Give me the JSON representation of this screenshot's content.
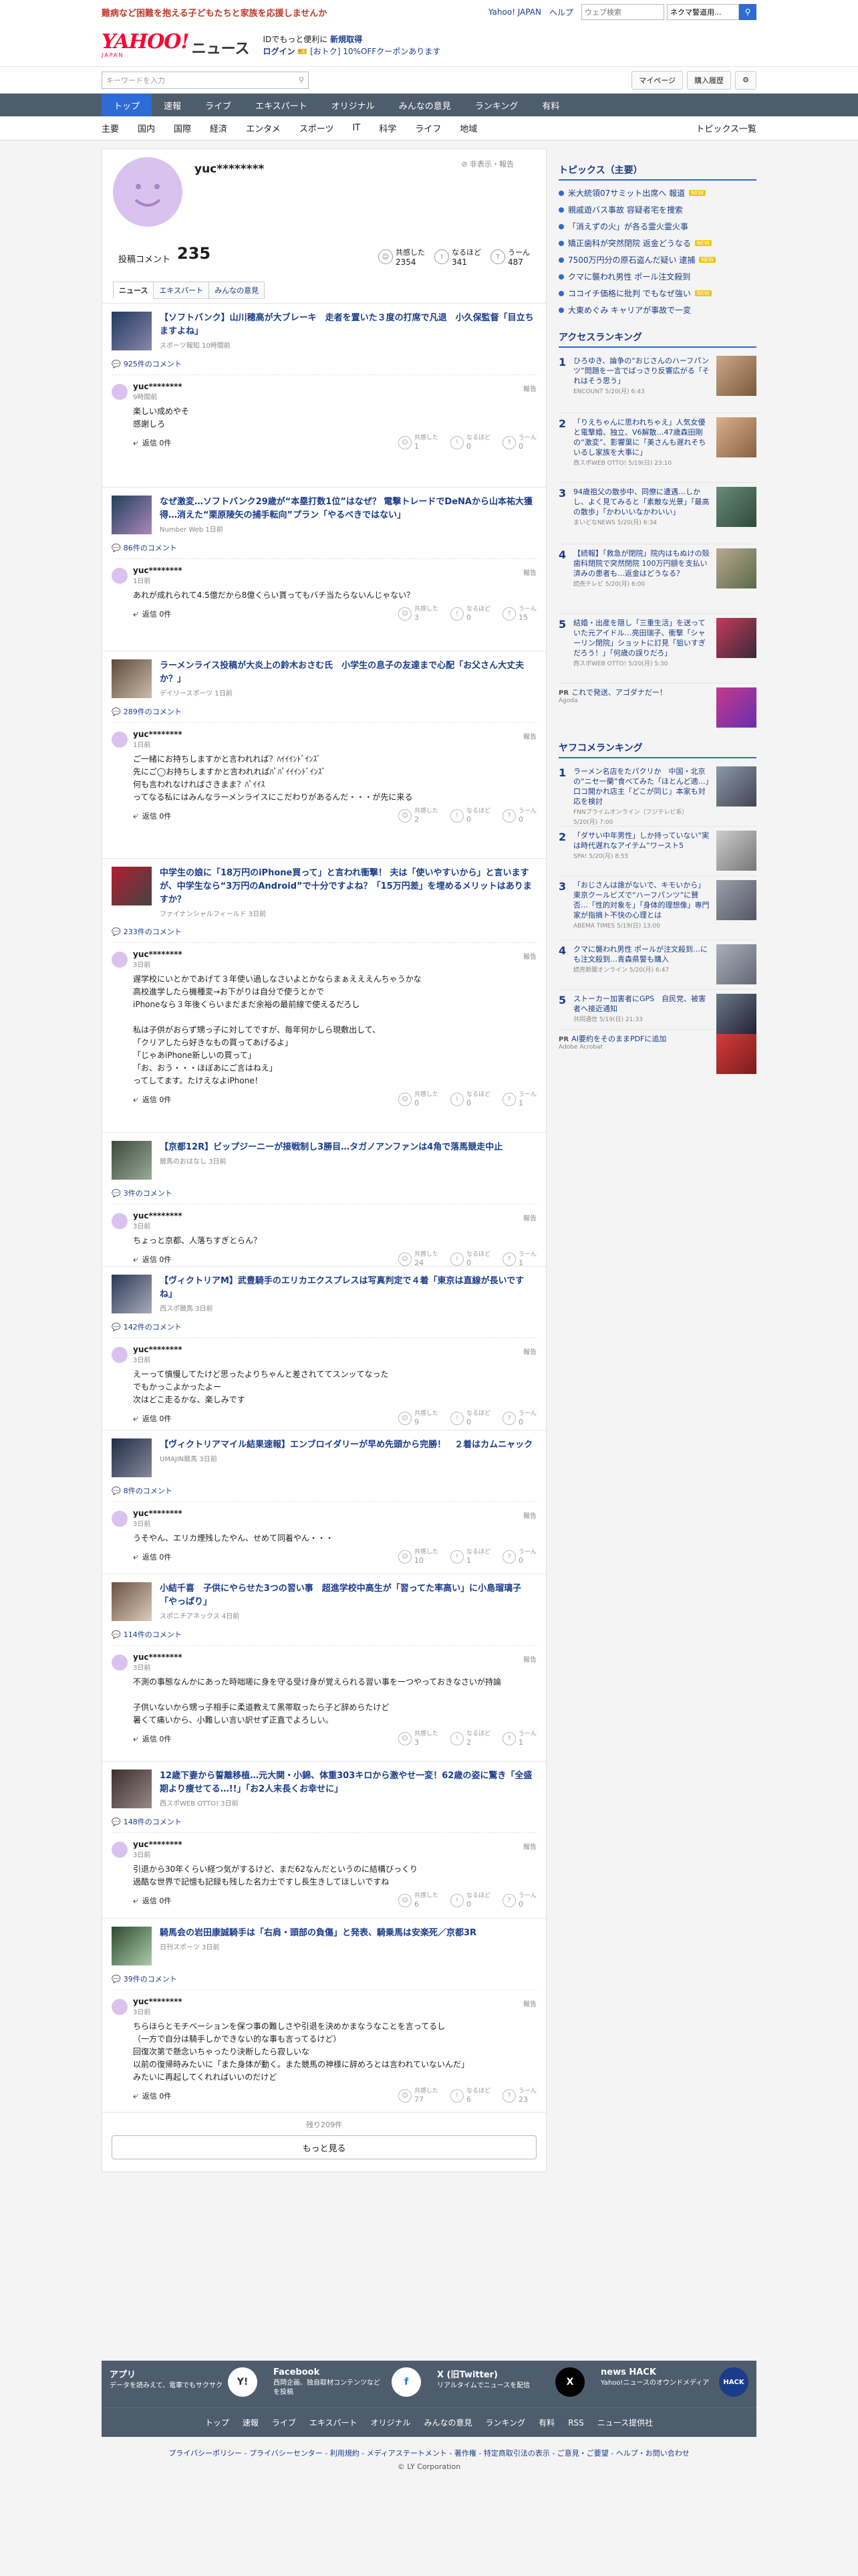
{
  "promo": {
    "text": "難病など困難を抱える子どもたちと家族を応援しませんか",
    "links": [
      "Yahoo! JAPAN",
      "ヘルプ"
    ],
    "search_placeholder": "ウェブ検索",
    "search_query": "ネクマ警道用..."
  },
  "header": {
    "logo": "YAHOO!",
    "logo_sub": "JAPAN",
    "service": "ニュース",
    "id_line": "IDでもっと便利に",
    "id_link": "新規取得",
    "login": "ログイン",
    "coupon": "[おトク] 10%OFFクーポンあります"
  },
  "search": {
    "placeholder": "キーワードを入力",
    "mypage": "マイページ",
    "history": "購入履歴"
  },
  "nav": [
    {
      "label": "トップ",
      "active": true
    },
    {
      "label": "速報"
    },
    {
      "label": "ライブ"
    },
    {
      "label": "エキスパート"
    },
    {
      "label": "オリジナル"
    },
    {
      "label": "みんなの意見"
    },
    {
      "label": "ランキング"
    },
    {
      "label": "有料"
    }
  ],
  "subnav": {
    "items": [
      "主要",
      "国内",
      "国際",
      "経済",
      "エンタメ",
      "スポーツ",
      "IT",
      "科学",
      "ライフ",
      "地域"
    ],
    "list": "トピックス一覧"
  },
  "profile": {
    "username": "yuc********",
    "hide": "非表示・報告",
    "count_label": "投稿コメント",
    "count": "235",
    "reacts": [
      {
        "label": "共感した",
        "num": "2354"
      },
      {
        "label": "なるほど",
        "num": "341"
      },
      {
        "label": "うーん",
        "num": "487"
      }
    ],
    "tabs": [
      "ニュース",
      "エキスパート",
      "みんなの意見"
    ]
  },
  "comments": [
    {
      "title": "【ソフトバンク】山川穂高が大ブレーキ　走者を置いた３度の打席で凡退　小久保監督「目立ちますよね」",
      "src": "スポーツ報知 10時間前",
      "count": "925件のコメント",
      "user": "yuc********",
      "time": "9時間前",
      "body": "楽しい成めやそ\n感謝しろ",
      "v": [
        "1",
        "0",
        "0"
      ]
    },
    {
      "title": "なぜ激変…ソフトバンク29歳が“本塁打数1位”はなぜ？ 電撃トレードでDeNAから山本祐大獲得…消えた“栗原陵矢の捕手転向”プラン「やるべきではない」",
      "src": "Number Web 1日前",
      "count": "86件のコメント",
      "user": "yuc********",
      "time": "1日前",
      "body": "あれが成れられて4.5億だから8億くらい貰ってもバチ当たらないんじゃない？",
      "v": [
        "3",
        "0",
        "15"
      ]
    },
    {
      "title": "ラーメンライス投稿が大炎上の鈴木おさむ氏　小学生の息子の友達まで心配「お父さん大丈夫か？」",
      "src": "デイリースポーツ 1日前",
      "count": "289件のコメント",
      "user": "yuc********",
      "time": "1日前",
      "body": "ご一緒にお持ちしますかと言われれば？ﾊｲｲｲﾝﾄﾞｲﾝｽﾞ\n先にご◯お持ちしますかと言われればﾊﾟﾊﾟｲｲｲﾝﾄﾞｲﾝｽﾞ\n何も言われなければさきまま？ﾊﾟｲｲｽ\nってなる私にはみんなラーメンライスにこだわりがあるんだ・・・が先に来る",
      "v": [
        "2",
        "0",
        "0"
      ]
    },
    {
      "title": "中学生の娘に「18万円のiPhone買って」と言われ衝撃！ 夫は「使いやすいから」と言いますが、中学生なら“3万円のAndroid”で十分ですよね？「15万円差」を埋めるメリットはありますか？",
      "src": "ファイナンシャルフィールド 3日前",
      "count": "233件のコメント",
      "user": "yuc********",
      "time": "3日前",
      "body": "遅学校にいとかであげて３年使い過しなさいよとかならまぁえええんちゃうかな\n高校進学したら機種変→お下がりは自分で使うとかで\niPhoneなら３年後くらいまだまだ余裕の最前線で使えるだろし\n\n私は子供がおらず甥っ子に対してですが、毎年何かしら現敷出して、\n「クリアしたら好きなもの買ってあげるよ」\n「じゃあiPhone新しいの買って」\n「お、おう・・・ほぼあにご言はねえ」\nってしてます。たけえなよiPhone！",
      "v": [
        "0",
        "0",
        "1"
      ]
    },
    {
      "title": "【京都12R】ビップジーニーが接戦制し3勝目…タガノアンファンは4角で落馬競走中止",
      "src": "競馬のおはなし 3日前",
      "count": "3件のコメント",
      "user": "yuc********",
      "time": "3日前",
      "body": "ちょっと京都、人落ちすぎとらん？",
      "v": [
        "24",
        "0",
        "1"
      ]
    },
    {
      "title": "【ヴィクトリアM】武豊騎手のエリカエクスプレスは写真判定で４着「東京は直線が長いですね」",
      "src": "西スポ競馬 3日前",
      "count": "142件のコメント",
      "user": "yuc********",
      "time": "3日前",
      "body": "えーって慎慢してたけど思ったよりちゃんと差されててスンッてなった\nでもかっこよかったよー\n次はどこ走るかな、楽しみです",
      "v": [
        "9",
        "0",
        "0"
      ]
    },
    {
      "title": "【ヴィクトリアマイル結果速報】エンブロイダリーが早め先頭から完勝！　２着はカムニャック",
      "src": "UMAJIN競馬 3日前",
      "count": "8件のコメント",
      "user": "yuc********",
      "time": "3日前",
      "body": "うそやん、エリカ煙残したやん、せめて同着やん・・・",
      "v": [
        "10",
        "1",
        "0"
      ]
    },
    {
      "title": "小結千喜　子供にやらせた3つの習い事　超進学校中高生が「習ってた率高い」に小島瑠璃子「やっぱり」",
      "src": "スポニチアネックス 4日前",
      "count": "114件のコメント",
      "user": "yuc********",
      "time": "3日前",
      "body": "不測の事態なんかにあった時咄嗟に身を守る受け身が覚えられる習い事を一つやっておきなさいが持論\n\n子供いないから甥っ子相手に柔道教えて黒帯取ったら子ど辞めらたけど\n暑くて痛いから、小難しい言い訳せず正直でよろしい。",
      "v": [
        "3",
        "2",
        "1"
      ]
    },
    {
      "title": "12歳下妻から誓離移植…元大関・小錦、体重303キロから激やせ一変！62歳の姿に驚き「全盛期より痩せてる…!!」「お2人末長くお幸せに」",
      "src": "西スポWEB OTTO! 3日前",
      "count": "148件のコメント",
      "user": "yuc********",
      "time": "3日前",
      "body": "引退から30年くらい経つ気がするけど、まだ62なんだというのに結構びっくり\n過酷な世界で記憶も記録も残した名力士ですし長生きしてほしいですね",
      "v": [
        "6",
        "0",
        "0"
      ]
    },
    {
      "title": "騎馬会の岩田康誠騎手は「右肩・頭部の負傷」と発表、騎乗馬は安楽死／京都3R",
      "src": "日刊スポーツ 3日前",
      "count": "39件のコメント",
      "user": "yuc********",
      "time": "3日前",
      "body": "ちらほらとモチベーションを保つ事の難しさや引退を決めかまなうなことを言ってるし\n（一方で自分は騎手しかできない的な事も言ってるけど）\n回復次第で懸念いちゃったり決断したら寂しいな\n以前の復帰時みたいに「また身体が動く。また競馬の神様に辞めろとは言われていないんだ」\nみたいに再起してくれればいいのだけど",
      "v": [
        "77",
        "6",
        "23"
      ]
    }
  ],
  "more": {
    "remaining": "残り209件",
    "button": "もっと見る"
  },
  "sidebar": {
    "topics_title": "トピックス（主要）",
    "topics": [
      {
        "t": "米大統領07サミット出席へ 報道",
        "new": true
      },
      {
        "t": "親戚遊バス事故 容疑者宅を捜索",
        "new": false
      },
      {
        "t": "「消えずの火」が各る霊火霊火事",
        "new": false
      },
      {
        "t": "矯正歯科が突然閉院 返金どうなる",
        "new": true
      },
      {
        "t": "7500万円分の原石盗んだ疑い 逮捕",
        "new": true
      },
      {
        "t": "クマに襲われ男性 ポール注文殺到",
        "new": false
      },
      {
        "t": "ココイチ価格に批判 でもなぜ強い",
        "new": true
      },
      {
        "t": "大東めぐみ キャリアが事故で一変",
        "new": false
      }
    ],
    "access_title": "アクセスランキング",
    "access": [
      {
        "t": "ひろゆき、論争の“おじさんのハーフパンツ”問題を一言でばっさり反響広がる「それはそう思う」",
        "s": "ENCOUNT 5/20(月) 6:43"
      },
      {
        "t": "「りえちゃんに思われちゃえ」人気女優と電撃婚、独立、V6解散…47歳森田剛の“激変”、影響葉に「美さんも遅れそちいるし家族を大事に」",
        "s": "西スポWEB OTTO! 5/19(日) 23:10"
      },
      {
        "t": "94歳祖父の散歩中、同僚に遭遇…しかし、よく見てみると「素敵な光景」「最高の散歩」「かわいいなかわいい」",
        "s": "まいどなNEWS 5/20(月) 6:34"
      },
      {
        "t": "【続報】「救急が閉院」院内はもぬけの殻 歯科閉院で突然閉院 100万円額を支払い済みの患者も…返金はどうなる？",
        "s": "読売テレビ 5/20(月) 6:00"
      },
      {
        "t": "結婚・出産を隠し「三重生活」を送っていた元アイドル…亮田瑞子、衝撃「シャーリン閉院」ショットに訂見「狙いすぎだろう！」「何歳の誤りだろ」",
        "s": "西スポWEB OTTO! 5/20(月) 5:30"
      }
    ],
    "pr1": {
      "tag": "PR",
      "t": "これで発送、アゴダナだー！",
      "s": "Agoda"
    },
    "yahoo_title": "ヤフコメランキング",
    "yahoo": [
      {
        "t": "ラーメン名店をたパクリか　中国・北京の“ニセ一蘭”食べてみた「ほとんど適…」　口コ開かれ店主「どこが同じ」本家も対応を検討",
        "s": "FNNプライムオンライン（フジテレビ系） 5/20(月) 7:00"
      },
      {
        "t": "「ダサい中年男性」しか持っていない”実は時代遅れなアイテム”ワースト5",
        "s": "SPA! 5/20(月) 8:55"
      },
      {
        "t": "「おじさんは誰がないで、キモいから」東京クールビズで“ハーフパンツ”に賛否…「性的対象を」「身体的理想像」専門家が指摘ト不快の心理とは",
        "s": "ABEMA TIMES 5/19(日) 13:00"
      },
      {
        "t": "クマに襲われ男性 ポールが注文殺到…にも注文殺到…青森県警も購入",
        "s": "読売新聞オンライン 5/20(月) 6:47"
      },
      {
        "t": "ストーカー加害者にGPS　自民党、被害者へ接近通知",
        "s": "共同通信 5/19(日) 21:33"
      }
    ],
    "pr2": {
      "tag": "PR",
      "t": "AI要約をそのままPDFに追加",
      "s": "Adobe Acrobat"
    }
  },
  "apps": [
    {
      "name": "アプリ",
      "desc": "データを読みえて、電車でもサクサク",
      "icon": "Y!"
    },
    {
      "name": "Facebook",
      "desc": "西岡企画、独自取材コンテンツなどを投稿",
      "icon": "f"
    },
    {
      "name": "X (旧Twitter)",
      "desc": "リアルタイムでニュースを配信",
      "icon": "X"
    },
    {
      "name": "news HACK",
      "desc": "Yahoo!ニュースのオウンドメディア",
      "icon": "HACK"
    }
  ],
  "footer_nav": [
    "トップ",
    "速報",
    "ライブ",
    "エキスパート",
    "オリジナル",
    "みんなの意見",
    "ランキング",
    "有料",
    "RSS",
    "ニュース提供社"
  ],
  "footer": {
    "links": "プライバシーポリシー - プライバシーセンター - 利用規約 - メディアステートメント - 著作権 - 特定商取引法の表示 - ご意見・ご要望 - ヘルプ・お問い合わせ",
    "copyright": "© LY Corporation"
  }
}
